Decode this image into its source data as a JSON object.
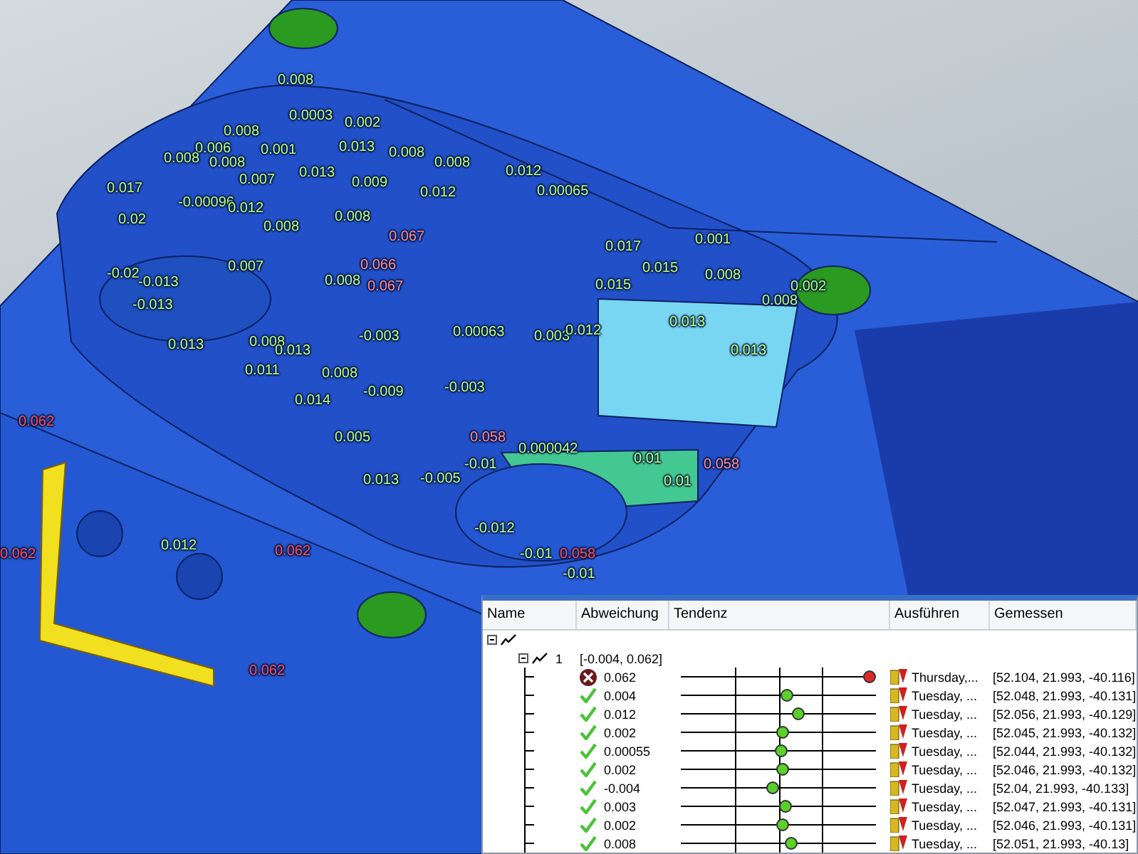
{
  "viewport": {
    "labels": [
      {
        "text": "0.008",
        "color": "#b8ff80"
      },
      {
        "text": "0.0003",
        "color": "#b8ff80"
      },
      {
        "text": "0.002",
        "color": "#b8ff80"
      },
      {
        "text": "0.008",
        "color": "#b8ff80"
      },
      {
        "text": "0.006",
        "color": "#b8ff80"
      },
      {
        "text": "0.008",
        "color": "#b8ff80"
      },
      {
        "text": "0.008",
        "color": "#b8ff80"
      },
      {
        "text": "0.001",
        "color": "#b8ff80"
      },
      {
        "text": "0.013",
        "color": "#b8ff80"
      },
      {
        "text": "0.008",
        "color": "#b8ff80"
      },
      {
        "text": "0.007",
        "color": "#b8ff80"
      },
      {
        "text": "0.013",
        "color": "#b8ff80"
      },
      {
        "text": "0.009",
        "color": "#b8ff80"
      },
      {
        "text": "0.017",
        "color": "#b8ff80"
      },
      {
        "text": "-0.00096",
        "color": "#b8ff80"
      },
      {
        "text": "0.012",
        "color": "#b8ff80"
      },
      {
        "text": "0.02",
        "color": "#b8ff80"
      },
      {
        "text": "0.008",
        "color": "#b8ff80"
      },
      {
        "text": "0.008",
        "color": "#b8ff80"
      },
      {
        "text": "0.007",
        "color": "#b8ff80"
      },
      {
        "text": "0.008",
        "color": "#b8ff80"
      },
      {
        "text": "-0.02",
        "color": "#b8ff80"
      },
      {
        "text": "-0.013",
        "color": "#b8ff80"
      },
      {
        "text": "-0.013",
        "color": "#b8ff80"
      },
      {
        "text": "0.067",
        "color": "#ff8a96"
      },
      {
        "text": "0.066",
        "color": "#ff8a96"
      },
      {
        "text": "0.067",
        "color": "#ff8a96"
      },
      {
        "text": "0.008",
        "color": "#b8ff80"
      },
      {
        "text": "0.012",
        "color": "#b8ff80"
      },
      {
        "text": "0.012",
        "color": "#b8ff80"
      },
      {
        "text": "0.00065",
        "color": "#b8ff80"
      },
      {
        "text": "0.017",
        "color": "#b8ff80"
      },
      {
        "text": "0.001",
        "color": "#b8ff80"
      },
      {
        "text": "0.015",
        "color": "#b8ff80"
      },
      {
        "text": "0.015",
        "color": "#b8ff80"
      },
      {
        "text": "0.008",
        "color": "#b8ff80"
      },
      {
        "text": "0.008",
        "color": "#b8ff80"
      },
      {
        "text": "0.002",
        "color": "#b8ff80"
      },
      {
        "text": "0.00063",
        "color": "#b8ff80"
      },
      {
        "text": "0.003",
        "color": "#b8ff80"
      },
      {
        "text": "0.012",
        "color": "#b8ff80"
      },
      {
        "text": "-0.003",
        "color": "#b8ff80"
      },
      {
        "text": "0.013",
        "color": "#b8ff80"
      },
      {
        "text": "0.013",
        "color": "#b8ff80"
      },
      {
        "text": "-0.003",
        "color": "#b8ff80"
      },
      {
        "text": "0.013",
        "color": "#b8ff80"
      },
      {
        "text": "0.008",
        "color": "#b8ff80"
      },
      {
        "text": "0.013",
        "color": "#b8ff80"
      },
      {
        "text": "0.011",
        "color": "#b8ff80"
      },
      {
        "text": "0.008",
        "color": "#b8ff80"
      },
      {
        "text": "0.014",
        "color": "#b8ff80"
      },
      {
        "text": "-0.009",
        "color": "#b8ff80"
      },
      {
        "text": "0.005",
        "color": "#b8ff80"
      },
      {
        "text": "0.013",
        "color": "#b8ff80"
      },
      {
        "text": "-0.005",
        "color": "#b8ff80"
      },
      {
        "text": "0.062",
        "color": "#ff4c5c"
      },
      {
        "text": "0.062",
        "color": "#ff4c5c"
      },
      {
        "text": "0.012",
        "color": "#b8ff80"
      },
      {
        "text": "0.062",
        "color": "#ff4c5c"
      },
      {
        "text": "0.062",
        "color": "#ff4c5c"
      },
      {
        "text": "0.058",
        "color": "#ff8a96"
      },
      {
        "text": "0.000042",
        "color": "#b8ff80"
      },
      {
        "text": "-0.01",
        "color": "#b8ff80"
      },
      {
        "text": "0.01",
        "color": "#b8ff80"
      },
      {
        "text": "0.058",
        "color": "#ff8a96"
      },
      {
        "text": "0.01",
        "color": "#b8ff80"
      },
      {
        "text": "-0.012",
        "color": "#b8ff80"
      },
      {
        "text": "-0.01",
        "color": "#b8ff80"
      },
      {
        "text": "0.058",
        "color": "#ff4c5c"
      },
      {
        "text": "-0.01",
        "color": "#b8ff80"
      }
    ]
  },
  "results_table": {
    "columns": [
      "Name",
      "Abweichung",
      "Tendenz",
      "Ausführen",
      "Gemessen"
    ],
    "tree": [
      {
        "kind": "group",
        "expanded": true,
        "children": [
          {
            "kind": "group",
            "expanded": true,
            "name": "1",
            "deviation": "[-0.004, 0.062]",
            "children": [
              {
                "kind": "measurement",
                "failed": true,
                "deviation": "0.062",
                "level": 0.96,
                "executed": "Thursday,...",
                "measured": "[52.104, 21.993, -40.116]"
              },
              {
                "kind": "measurement",
                "failed": false,
                "deviation": "0.004",
                "level": 0.54,
                "executed": "Tuesday, ...",
                "measured": "[52.048, 21.993, -40.131]"
              },
              {
                "kind": "measurement",
                "failed": false,
                "deviation": "0.012",
                "level": 0.6,
                "executed": "Tuesday, ...",
                "measured": "[52.056, 21.993, -40.129]"
              },
              {
                "kind": "measurement",
                "failed": false,
                "deviation": "0.002",
                "level": 0.52,
                "executed": "Tuesday, ...",
                "measured": "[52.045, 21.993, -40.132]"
              },
              {
                "kind": "measurement",
                "failed": false,
                "deviation": "0.00055",
                "level": 0.51,
                "executed": "Tuesday, ...",
                "measured": "[52.044, 21.993, -40.132]"
              },
              {
                "kind": "measurement",
                "failed": false,
                "deviation": "0.002",
                "level": 0.52,
                "executed": "Tuesday, ...",
                "measured": "[52.046, 21.993, -40.132]"
              },
              {
                "kind": "measurement",
                "failed": false,
                "deviation": "-0.004",
                "level": 0.47,
                "executed": "Tuesday, ...",
                "measured": "[52.04, 21.993, -40.133]"
              },
              {
                "kind": "measurement",
                "failed": false,
                "deviation": "0.003",
                "level": 0.53,
                "executed": "Tuesday, ...",
                "measured": "[52.047, 21.993, -40.131]"
              },
              {
                "kind": "measurement",
                "failed": false,
                "deviation": "0.002",
                "level": 0.52,
                "executed": "Tuesday, ...",
                "measured": "[52.046, 21.993, -40.131]"
              },
              {
                "kind": "measurement",
                "failed": false,
                "deviation": "0.008",
                "level": 0.56,
                "executed": "Tuesday, ...",
                "measured": "[52.051, 21.993, -40.13]"
              }
            ]
          }
        ]
      }
    ]
  }
}
